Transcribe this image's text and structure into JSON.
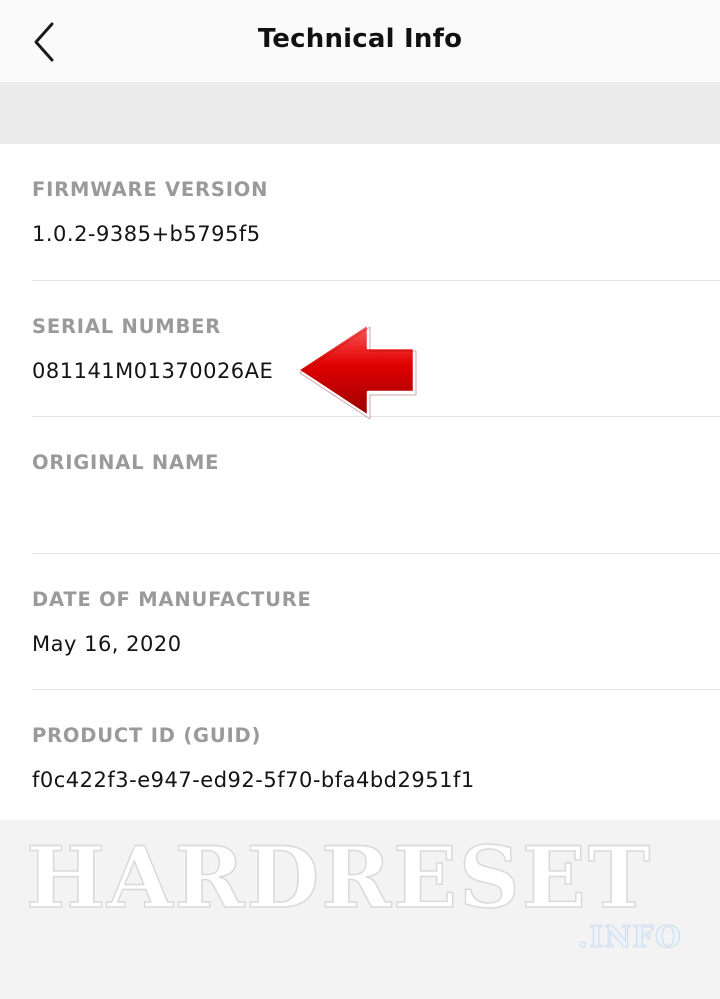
{
  "header": {
    "title": "Technical Info",
    "back_icon": "chevron-left-icon"
  },
  "info": {
    "firmware": {
      "label": "FIRMWARE VERSION",
      "value": "1.0.2-9385+b5795f5"
    },
    "serial": {
      "label": "SERIAL NUMBER",
      "value": "081141M01370026AE"
    },
    "original_name": {
      "label": "ORIGINAL NAME",
      "value": ""
    },
    "manufacture_date": {
      "label": "DATE OF MANUFACTURE",
      "value": "May 16, 2020"
    },
    "product_id": {
      "label": "PRODUCT ID (GUID)",
      "value": "f0c422f3-e947-ed92-5f70-bfa4bd2951f1"
    }
  },
  "annotation": {
    "arrow_icon": "red-arrow-left-icon",
    "arrow_color": "#d40000"
  },
  "watermark": {
    "main": "HARDRESET",
    "sub": ".INFO"
  },
  "colors": {
    "label": "#9a9a9a",
    "value": "#141414",
    "divider": "#e3e3e3",
    "band": "#ececec"
  }
}
